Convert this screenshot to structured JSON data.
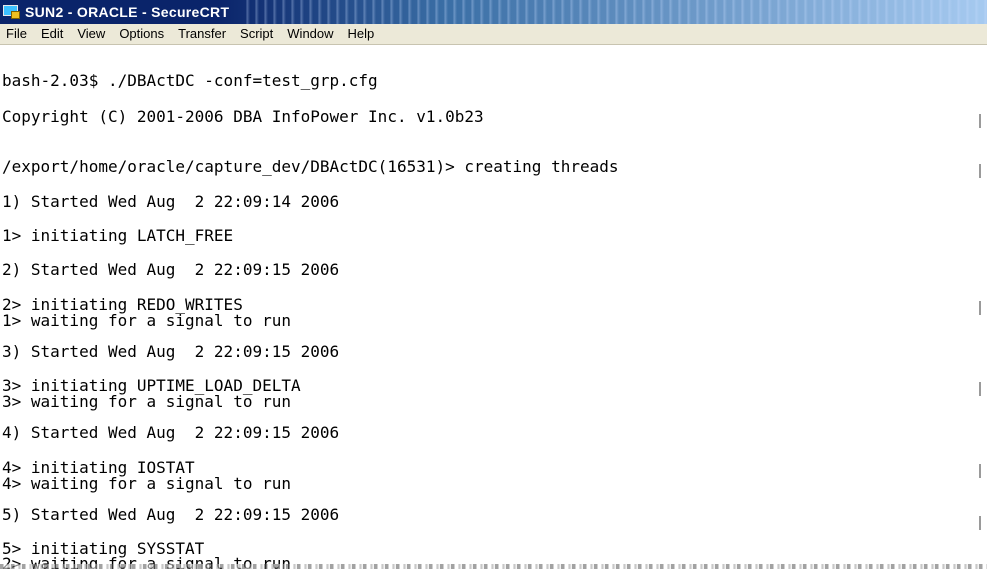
{
  "window": {
    "title": "SUN2 - ORACLE - SecureCRT"
  },
  "menu": {
    "items": [
      {
        "label": "File"
      },
      {
        "label": "Edit"
      },
      {
        "label": "View"
      },
      {
        "label": "Options"
      },
      {
        "label": "Transfer"
      },
      {
        "label": "Script"
      },
      {
        "label": "Window"
      },
      {
        "label": "Help"
      }
    ]
  },
  "terminal": {
    "lines": [
      "bash-2.03$ ./DBActDC -conf=test_grp.cfg",
      "Copyright (C) 2001-2006 DBA InfoPower Inc. v1.0b23",
      "/export/home/oracle/capture_dev/DBActDC(16531)> creating threads",
      "1) Started Wed Aug  2 22:09:14 2006",
      "1> initiating LATCH_FREE",
      "2) Started Wed Aug  2 22:09:15 2006",
      "2> initiating REDO_WRITES",
      "1> waiting for a signal to run",
      "3) Started Wed Aug  2 22:09:15 2006",
      "3> initiating UPTIME_LOAD_DELTA",
      "3> waiting for a signal to run",
      "4) Started Wed Aug  2 22:09:15 2006",
      "4> initiating IOSTAT",
      "4> waiting for a signal to run",
      "5) Started Wed Aug  2 22:09:15 2006",
      "5> initiating SYSSTAT",
      "2> waiting for a signal to run"
    ]
  },
  "colors": {
    "titlebar_start": "#0a246a",
    "titlebar_end": "#a6caf0",
    "menubar_bg": "#ece9d8",
    "terminal_bg": "#ffffff",
    "terminal_fg": "#000000"
  },
  "icons": {
    "app": "securecrt-app-icon"
  }
}
